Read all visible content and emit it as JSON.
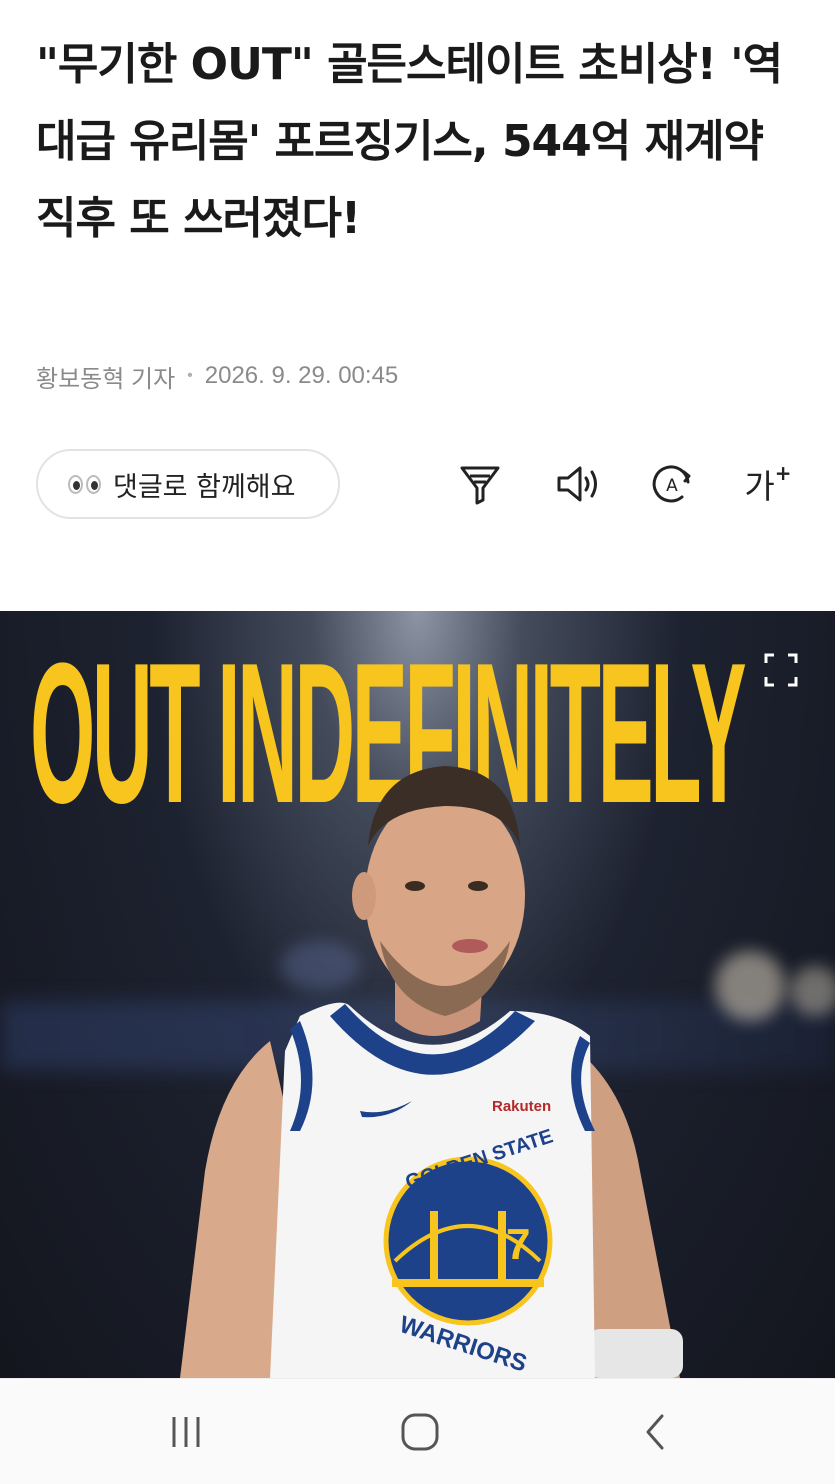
{
  "article": {
    "title": "\"무기한 OUT\" 골든스테이트 초비상! '역대급 유리몸' 포르징기스, 544억 재계약 직후 또 쓰러졌다!",
    "reporter": "황보동혁 기자",
    "datetime": "2026. 9. 29. 00:45"
  },
  "actions": {
    "comment_label": "댓글로 함께해요",
    "font_size_label": "가",
    "font_size_plus": "+",
    "icons": [
      "summary-icon",
      "speaker-icon",
      "translate-icon",
      "font-size-icon"
    ]
  },
  "hero_image": {
    "headline_text": "OUT INDEFINITELY",
    "jersey_brand": "Rakuten",
    "jersey_team_top": "GOLDEN STATE",
    "jersey_team_bottom": "WARRIORS",
    "jersey_number": "7",
    "colors": {
      "headline_yellow": "#f7c51e",
      "jersey_blue": "#1d428a",
      "jersey_white": "#f5f5f5"
    }
  },
  "nav": {
    "icons": [
      "recents-icon",
      "home-icon",
      "back-icon"
    ]
  }
}
